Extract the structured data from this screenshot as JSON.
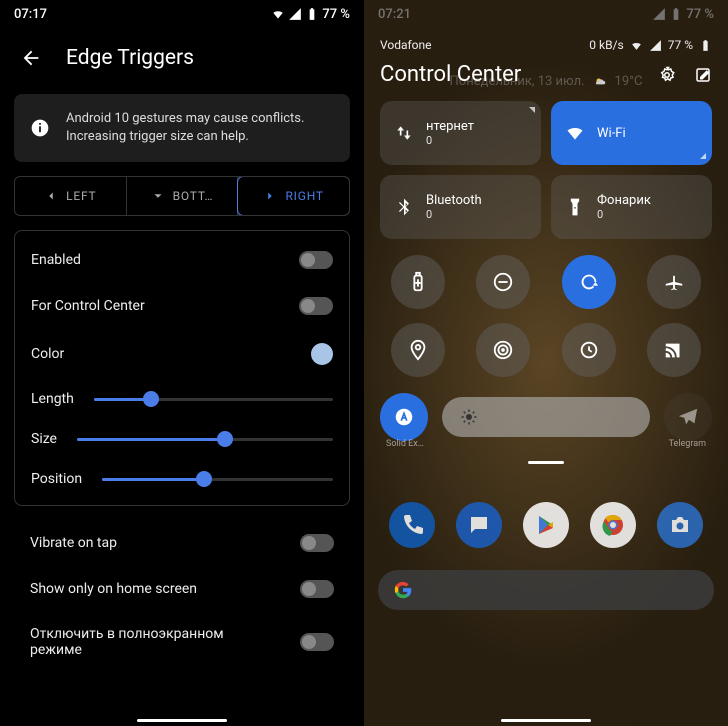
{
  "left": {
    "statusbar": {
      "time": "07:17",
      "battery_text": "77 %"
    },
    "title": "Edge Triggers",
    "info_text": "Android 10 gestures may cause conflicts. Increasing trigger size can help.",
    "tabs": {
      "left": "LEFT",
      "bottom": "BOTT…",
      "right": "RIGHT"
    },
    "settings": {
      "enabled": "Enabled",
      "for_cc": "For Control Center",
      "color": "Color",
      "length": "Length",
      "size": "Size",
      "position": "Position",
      "vibrate": "Vibrate on tap",
      "home_only": "Show only on home screen",
      "fullscreen": "Отключить в полноэкранном режиме"
    },
    "sliders": {
      "length_pct": 24,
      "size_pct": 58,
      "position_pct": 44
    },
    "color_swatch": "#a8c5e8"
  },
  "right": {
    "statusbar": {
      "time": "07:21",
      "battery_text": "77 %"
    },
    "carrier": "Vodafone",
    "speed": "0 kB/s",
    "bg_date": "Понедельник, 13 июл.",
    "bg_temp": "19°C",
    "title": "Control Center",
    "tiles": [
      {
        "title": "нтернет",
        "sub": "0",
        "active": false,
        "icon": "data-icon"
      },
      {
        "title": "Wi-Fi",
        "sub": "",
        "active": true,
        "icon": "wifi-icon"
      },
      {
        "title": "Bluetooth",
        "sub": "0",
        "active": false,
        "icon": "bluetooth-icon"
      },
      {
        "title": "Фонарик",
        "sub": "0",
        "active": false,
        "icon": "flashlight-icon"
      }
    ],
    "round_icons": [
      "battery-icon",
      "dnd-icon",
      "rotate-icon",
      "airplane-icon",
      "location-icon",
      "hotspot-icon",
      "sync-icon",
      "cast-icon"
    ],
    "round_active_index": 2,
    "auto_brightness_active": true,
    "app_labels": {
      "left": "Solid Ex…",
      "right": "Telegram"
    }
  }
}
